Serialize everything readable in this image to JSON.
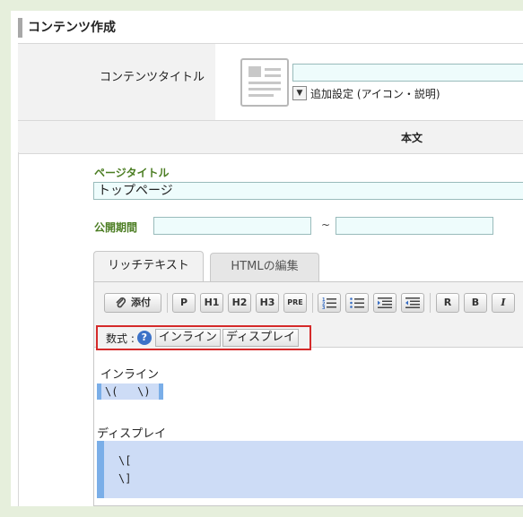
{
  "heading": "コンテンツ作成",
  "content_title": {
    "label": "コンテンツタイトル",
    "value": "",
    "advanced_toggle": "追加設定 (アイコン・説明)"
  },
  "body_header": "本文",
  "page_title": {
    "label": "ページタイトル",
    "value": "トップページ"
  },
  "period": {
    "label": "公開期間",
    "start": "",
    "separator": "~",
    "end": ""
  },
  "tabs": [
    {
      "label": "リッチテキスト",
      "active": true
    },
    {
      "label": "HTMLの編集",
      "active": false
    }
  ],
  "toolbar": {
    "attach": "添付",
    "p": "P",
    "h1": "H1",
    "h2": "H2",
    "h3": "H3",
    "pre": "PRE",
    "bold_r": "R",
    "bold_b": "B",
    "italic": "I"
  },
  "formula": {
    "label": "数式 :",
    "inline_button": "インライン",
    "display_button": "ディスプレイ"
  },
  "editor_content": {
    "inline_label": "インライン",
    "inline_code": "\\(   \\)",
    "display_label": "ディスプレイ",
    "display_code_start": "\\[",
    "display_code_end": "\\]"
  },
  "colors": {
    "green_label": "#4b7d22",
    "highlight_border": "#d52a2a",
    "math_background": "#cddcf6",
    "math_bar": "#7aaee8"
  }
}
